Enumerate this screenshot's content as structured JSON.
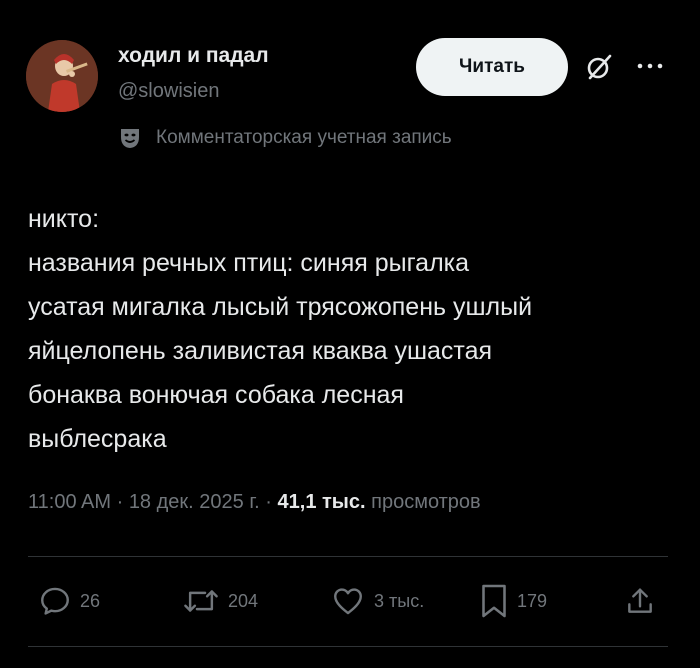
{
  "author": {
    "display_name": "ходил и падал",
    "handle": "@slowisien"
  },
  "header": {
    "follow_label": "Читать",
    "grok_icon": "grok-icon",
    "more_icon": "more-dots-icon"
  },
  "account_type": {
    "icon": "theater-mask-icon",
    "label": "Комментаторская учетная запись"
  },
  "tweet": {
    "lines": [
      "никто:",
      "названия речных птиц: синяя рыгалка",
      "усатая мигалка лысый трясожопень ушлый",
      "яйцелопень заливистая кваква ушастая",
      "бонаква вонючая собака лесная",
      "выблесрака"
    ]
  },
  "meta": {
    "time": "11:00 AM",
    "separator": " · ",
    "date": "18 дек. 2025 г.",
    "views_count": "41,1 тыс.",
    "views_label": "просмотров"
  },
  "actions": {
    "replies": "26",
    "reposts": "204",
    "likes": "3 тыс.",
    "bookmarks": "179"
  },
  "colors": {
    "background": "#000000",
    "text_primary": "#e7e9ea",
    "text_secondary": "#71767b",
    "button_bg": "#eff3f4",
    "divider": "#2f3336"
  }
}
